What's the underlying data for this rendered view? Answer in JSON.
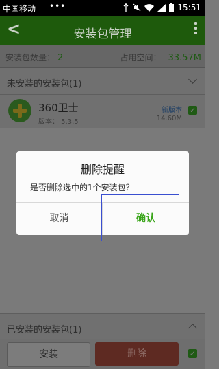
{
  "status_bar": {
    "carrier": "中国移动",
    "time": "15:51",
    "dots": "•••",
    "icons": [
      "usb-icon",
      "mute-icon",
      "wifi-icon",
      "signal-icon",
      "battery-icon"
    ]
  },
  "app_bar": {
    "back": "<",
    "title": "安装包管理"
  },
  "info": {
    "count_label": "安装包数量：",
    "count_value": "2",
    "space_label": "占用空间：",
    "space_value": "33.57M"
  },
  "sections": {
    "uninstalled": "未安装的安装包(1)",
    "installed": "已安装的安装包(1)"
  },
  "package": {
    "name": "360卫士",
    "version": "版本： 5.3.5",
    "badge": "新版本",
    "size": "14.60M"
  },
  "dialog": {
    "title": "删除提醒",
    "message": "是否删除选中的1个安装包？",
    "cancel": "取消",
    "confirm": "确认"
  },
  "bottom": {
    "install": "安装",
    "delete": "删除"
  },
  "colors": {
    "accent_green": "#3aa51a",
    "highlight_box": "#3a4fd0"
  }
}
